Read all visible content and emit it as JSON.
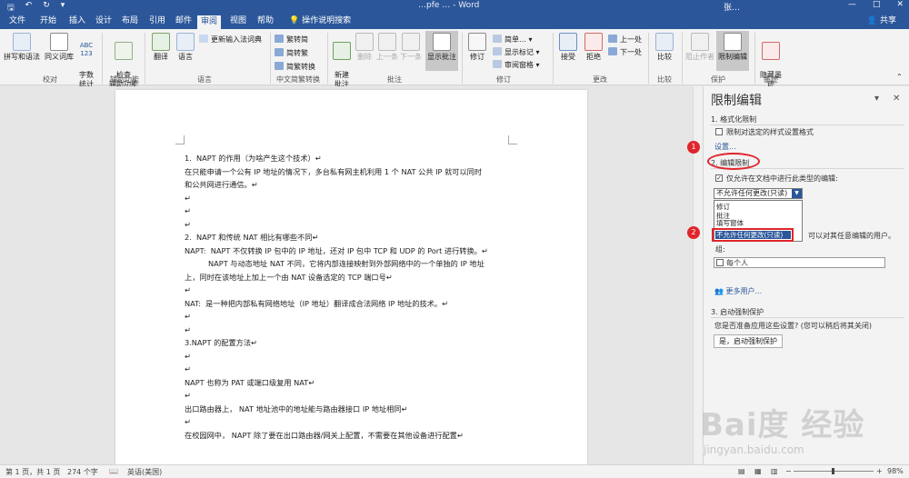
{
  "titlebar": {
    "doc_title": "…pfe … - Word",
    "user": "张…",
    "win_min": "—",
    "win_max": "□",
    "win_close": "✕"
  },
  "tabs": [
    "文件",
    "开始",
    "插入",
    "设计",
    "布局",
    "引用",
    "邮件",
    "审阅",
    "视图",
    "帮助"
  ],
  "active_tab": "审阅",
  "tell_me": "操作说明搜索",
  "share": "共享",
  "ribbon": {
    "spell": "拼写和语法",
    "thesaurus": "同义词库",
    "wordcount_icon_text": "ABC\n123",
    "wordcount": "字数\n统计",
    "proofing_group": "校对",
    "check_access": "检查\n辅助功能",
    "access_group": "辅助功能",
    "translate": "翻译",
    "language": "语言",
    "update_ime": "更新输入法词典",
    "language_group": "语言",
    "to_trad": "繁转简",
    "to_simp": "简转繁",
    "convert": "简繁转换",
    "chinese_group": "中文简繁转换",
    "new_comment": "新建\n批注",
    "delete": "删除",
    "previous": "上一条",
    "next": "下一条",
    "show_comments": "显示批注",
    "comments_group": "批注",
    "track": "修订",
    "simple_markup": "简单…",
    "show_markup": "显示标记",
    "review_pane": "审阅窗格",
    "tracking_group": "修订",
    "accept": "接受",
    "reject": "拒绝",
    "prev_change": "上一处",
    "next_change": "下一处",
    "changes_group": "更改",
    "compare": "比较",
    "compare_group": "比较",
    "block_authors": "阻止作者",
    "restrict_editing": "限制编辑",
    "protect_group": "保护",
    "hide_ink": "隐藏墨\n迹",
    "ink_group": "墨迹"
  },
  "document": {
    "lines": [
      "1.  NAPT 的作用（为啥产生这个技术）↵",
      "在只能申请一个公有 IP 地址的情况下，多台私有网主机利用 1 个 NAT 公共 IP 就可以同时",
      "和公共网进行通信。↵",
      "↵",
      "↵",
      "↵",
      "2.  NAPT 和传统 NAT 相比有哪些不同↵",
      "NAPT:  NAPT 不仅转换 IP 包中的 IP 地址，还对 IP 包中 TCP 和 UDP 的 Port 进行转换。↵",
      "          NAPT 与动态地址 NAT 不同，它将内部连接映射到外部网络中的一个单独的 IP 地址",
      "上，同时在该地址上加上一个由 NAT 设备选定的 TCP 端口号↵",
      "↵",
      "NAT:  是一种把内部私有网络地址（IP 地址）翻译成合法网络 IP 地址的技术。↵",
      "↵",
      "↵",
      "3.NAPT 的配置方法↵",
      "↵",
      "↵",
      "NAPT 也称为 PAT 或端口级复用 NAT↵",
      "↵",
      "出口路由器上， NAT 地址池中的地址能与路由器接口 IP 地址相同↵",
      "↵",
      "在校园网中， NAPT 除了要在出口路由器/网关上配置，不需要在其他设备进行配置↵"
    ]
  },
  "pane": {
    "title": "限制编辑",
    "section1": "1. 格式化限制",
    "section1_check": "限制对选定的样式设置格式",
    "settings_link": "设置...",
    "section2": "2. 编辑限制",
    "section2_check": "仅允许在文档中进行此类型的编辑:",
    "dropdown_value": "不允许任何更改(只读)",
    "options": [
      "修订",
      "批注",
      "填写窗体",
      "不允许任何更改(只读)"
    ],
    "exceptions_tail": "可以对其任意编辑的用户。",
    "group_label": "组:",
    "everyone": "每个人",
    "more_users": "更多用户...",
    "section3": "3. 启动强制保护",
    "section3_question": "您是否准备应用这些设置? (您可以稍后将其关闭)",
    "start_button": "是，启动强制保护",
    "marker1": "1",
    "marker2": "2"
  },
  "statusbar": {
    "page": "第 1 页，共 1 页",
    "words": "274 个字",
    "lang": "英语(美国)",
    "zoom": "98%",
    "zoom_level": 0.98
  },
  "watermark": {
    "big": "Bai度 经验",
    "small": "jingyan.baidu.com"
  },
  "colors": {
    "accent": "#2b579a",
    "annotation": "#e0262b"
  }
}
